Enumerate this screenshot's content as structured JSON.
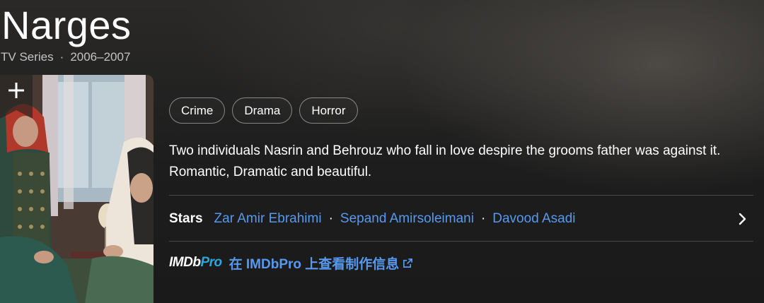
{
  "title": "Narges",
  "meta": {
    "type": "TV Series",
    "separator": "·",
    "years": "2006–2007"
  },
  "poster": {
    "watchlist_icon": "plus-icon"
  },
  "genres": [
    "Crime",
    "Drama",
    "Horror"
  ],
  "plot": "Two individuals Nasrin and Behrouz who fall in love despire the grooms father was against it. Romantic, Dramatic and beautiful.",
  "stars": {
    "label": "Stars",
    "names": [
      "Zar Amir Ebrahimi",
      "Sepand Amirsoleimani",
      "Davood Asadi"
    ],
    "separator": "·",
    "chevron_icon": "chevron-right-icon"
  },
  "imdbpro": {
    "logo_imdb": "IMDb",
    "logo_pro": "Pro",
    "link_text": "在 IMDbPro 上查看制作信息",
    "link_icon": "external-link-icon"
  },
  "colors": {
    "link": "#5799ef",
    "pro_accent": "#29a6e0",
    "background": "#1f1f1f"
  }
}
